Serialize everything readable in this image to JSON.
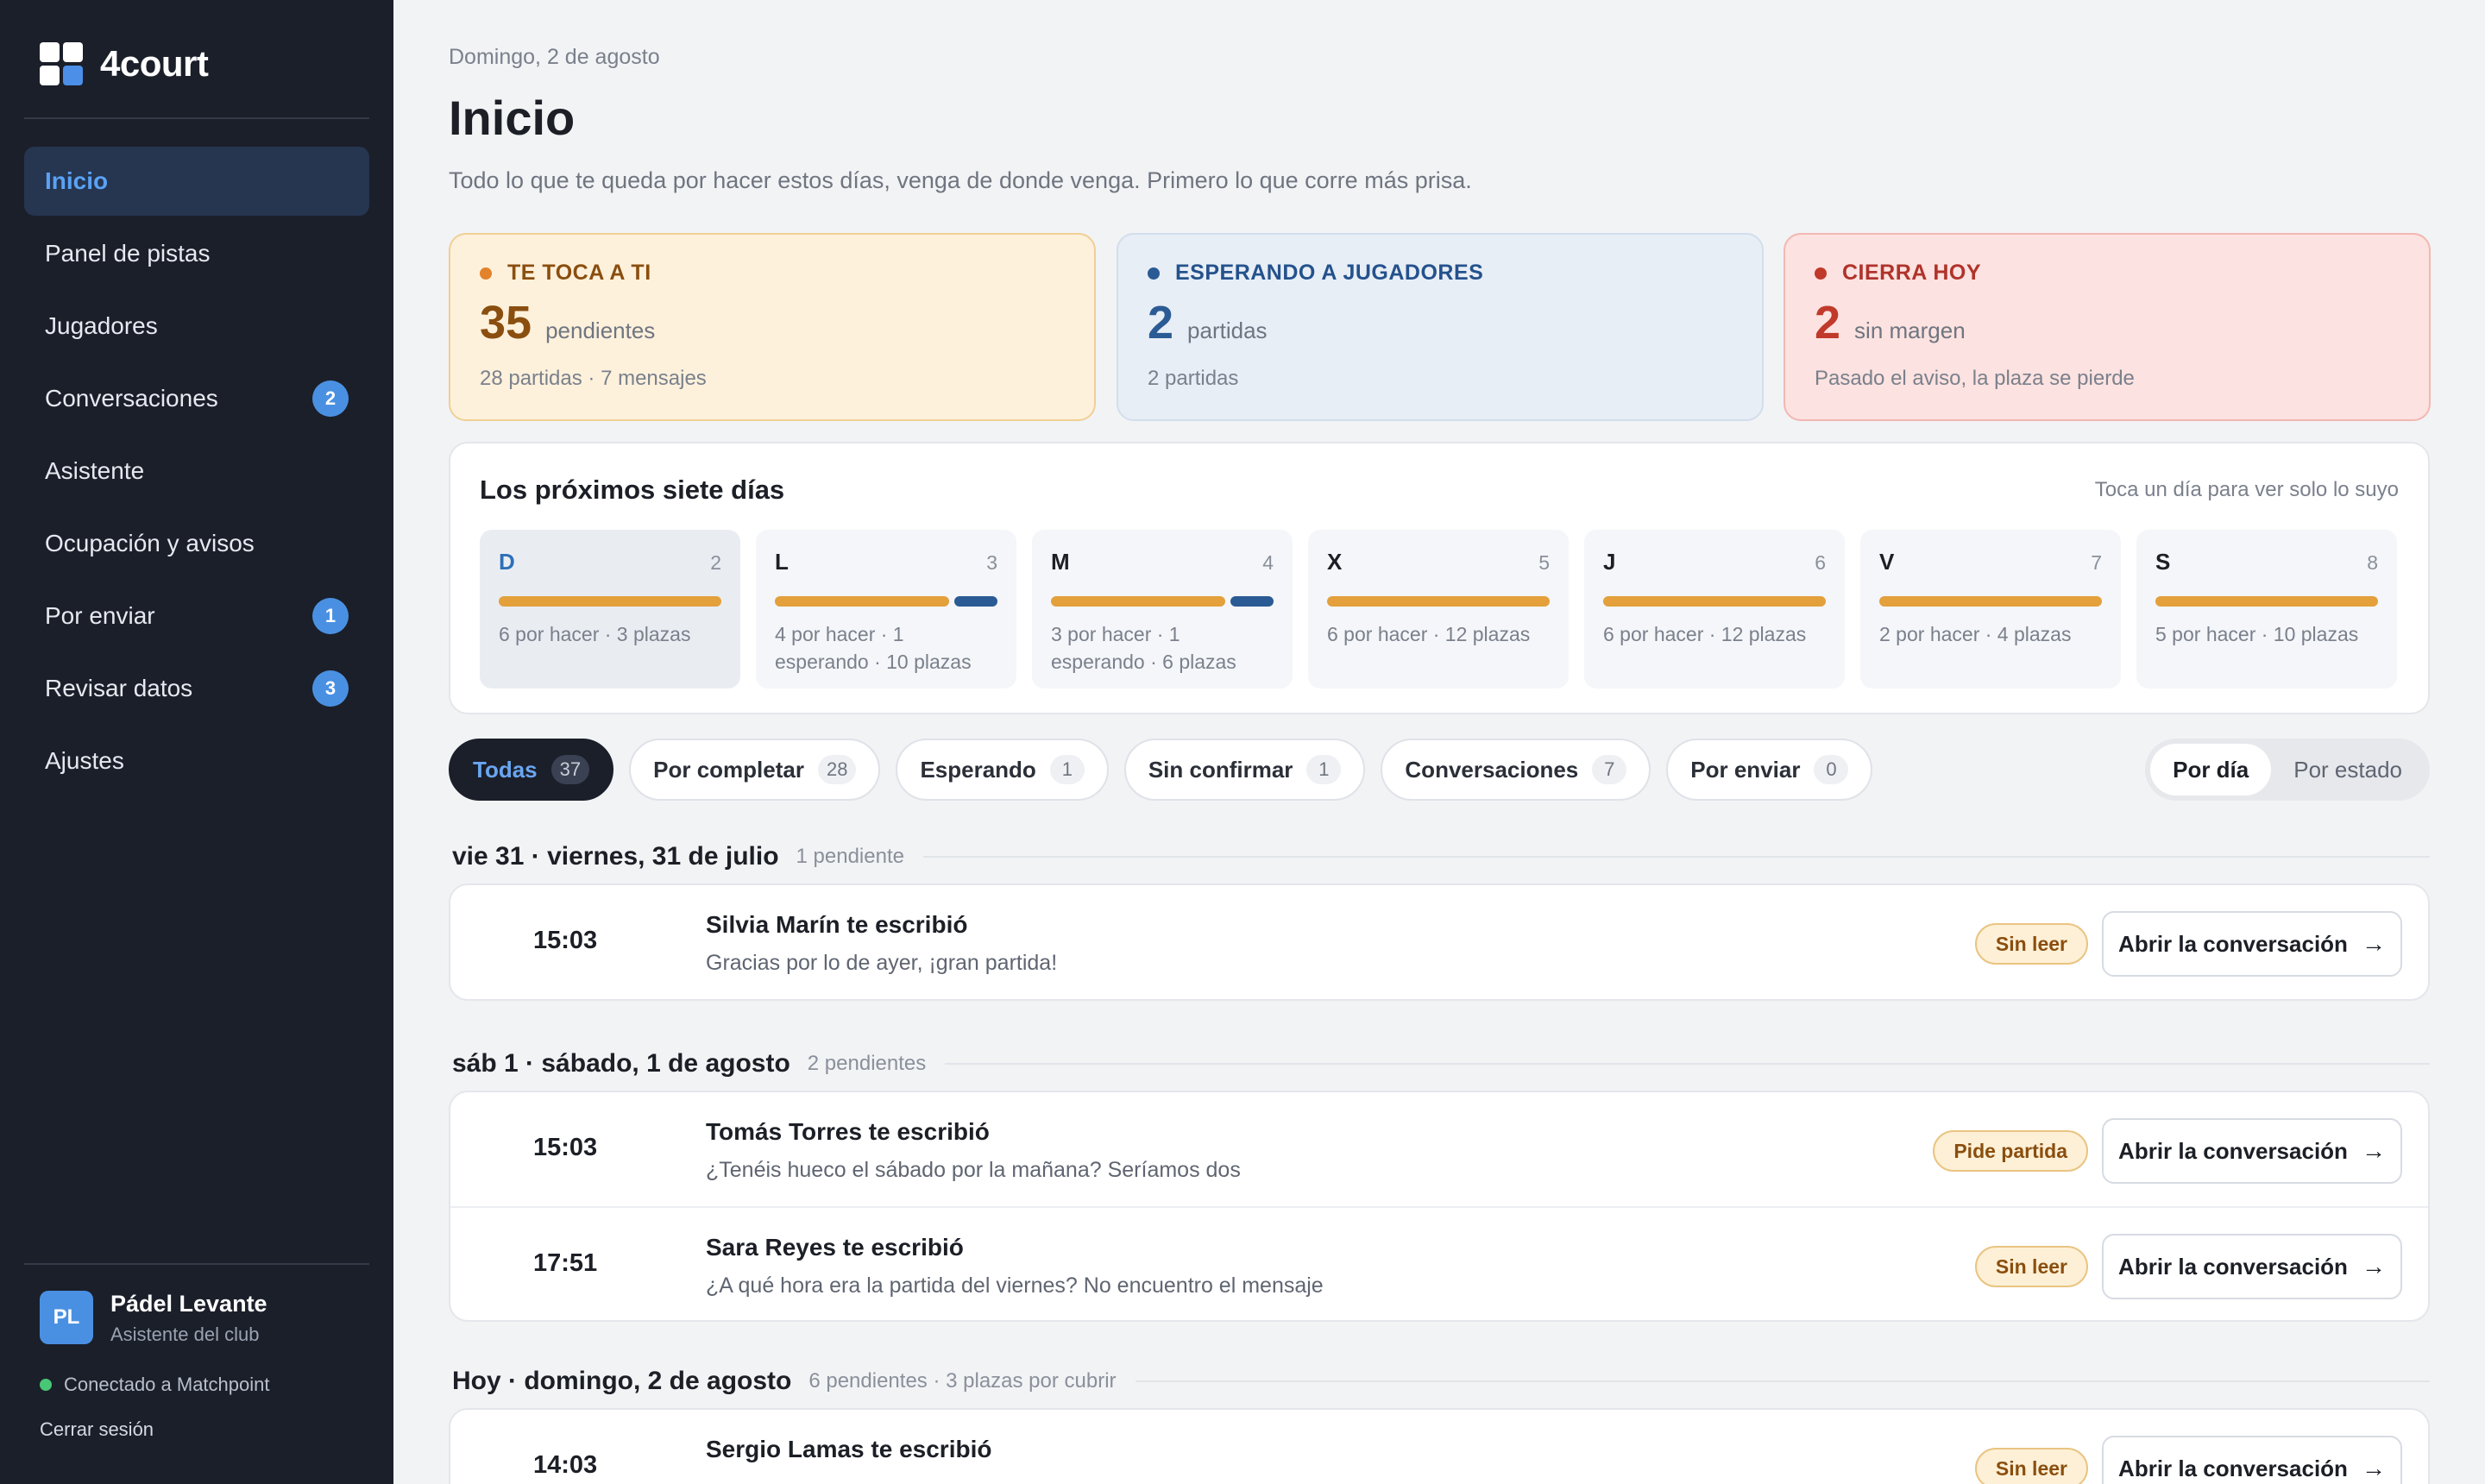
{
  "app": {
    "name": "4court"
  },
  "sidebar": {
    "items": [
      {
        "label": "Inicio",
        "active": true
      },
      {
        "label": "Panel de pistas"
      },
      {
        "label": "Jugadores"
      },
      {
        "label": "Conversaciones",
        "badge": "2"
      },
      {
        "label": "Asistente"
      },
      {
        "label": "Ocupación y avisos"
      },
      {
        "label": "Por enviar",
        "badge": "1"
      },
      {
        "label": "Revisar datos",
        "badge": "3"
      },
      {
        "label": "Ajustes"
      }
    ],
    "profile": {
      "initials": "PL",
      "name": "Pádel Levante",
      "role": "Asistente del club",
      "status": "Conectado a Matchpoint",
      "logout": "Cerrar sesión"
    }
  },
  "header": {
    "date": "Domingo, 2 de agosto",
    "title": "Inicio",
    "subtitle": "Todo lo que te queda por hacer estos días, venga de donde venga. Primero lo que corre más prisa."
  },
  "kpis": [
    {
      "label": "TE TOCA A TI",
      "value": "35",
      "unit": "pendientes",
      "detail": "28 partidas · 7 mensajes"
    },
    {
      "label": "ESPERANDO A JUGADORES",
      "value": "2",
      "unit": "partidas",
      "detail": "2 partidas"
    },
    {
      "label": "CIERRA HOY",
      "value": "2",
      "unit": "sin margen",
      "detail": "Pasado el aviso, la plaza se pierde"
    }
  ],
  "week": {
    "title": "Los próximos siete días",
    "hint": "Toca un día para ver solo lo suyo",
    "days": [
      {
        "letter": "D",
        "num": "2",
        "detail": "6 por hacer · 3 plazas",
        "waiting": false,
        "selected": true
      },
      {
        "letter": "L",
        "num": "3",
        "detail": "4 por hacer · 1 esperando · 10 plazas",
        "waiting": true
      },
      {
        "letter": "M",
        "num": "4",
        "detail": "3 por hacer · 1 esperando · 6 plazas",
        "waiting": true
      },
      {
        "letter": "X",
        "num": "5",
        "detail": "6 por hacer · 12 plazas",
        "waiting": false
      },
      {
        "letter": "J",
        "num": "6",
        "detail": "6 por hacer · 12 plazas",
        "waiting": false
      },
      {
        "letter": "V",
        "num": "7",
        "detail": "2 por hacer · 4 plazas",
        "waiting": false
      },
      {
        "letter": "S",
        "num": "8",
        "detail": "5 por hacer · 10 plazas",
        "waiting": false
      }
    ]
  },
  "filters": [
    {
      "label": "Todas",
      "count": "37",
      "active": true
    },
    {
      "label": "Por completar",
      "count": "28"
    },
    {
      "label": "Esperando",
      "count": "1"
    },
    {
      "label": "Sin confirmar",
      "count": "1"
    },
    {
      "label": "Conversaciones",
      "count": "7"
    },
    {
      "label": "Por enviar",
      "count": "0"
    }
  ],
  "view_toggle": {
    "by_day": "Por día",
    "by_state": "Por estado"
  },
  "groups": [
    {
      "title": "vie 31 · viernes, 31 de julio",
      "meta": "1 pendiente",
      "rows": [
        {
          "time": "15:03",
          "title": "Silvia Marín te escribió",
          "msg": "Gracias por lo de ayer, ¡gran partida!",
          "tag": "Sin leer",
          "action": "Abrir la conversación"
        }
      ]
    },
    {
      "title": "sáb 1 · sábado, 1 de agosto",
      "meta": "2 pendientes",
      "rows": [
        {
          "time": "15:03",
          "title": "Tomás Torres te escribió",
          "msg": "¿Tenéis hueco el sábado por la mañana? Seríamos dos",
          "tag": "Pide partida",
          "action": "Abrir la conversación"
        },
        {
          "time": "17:51",
          "title": "Sara Reyes te escribió",
          "msg": "¿A qué hora era la partida del viernes? No encuentro el mensaje",
          "tag": "Sin leer",
          "action": "Abrir la conversación"
        }
      ]
    },
    {
      "title": "Hoy · domingo, 2 de agosto",
      "meta": "6 pendientes · 3 plazas por cubrir",
      "rows": [
        {
          "time": "14:03",
          "title": "Sergio Lamas te escribió",
          "msg": "",
          "tag": "Sin leer",
          "action": "Abrir la conversación"
        }
      ]
    }
  ],
  "colors": {
    "sidebar_bg": "#1b1f2a",
    "accent_blue": "#4a90e2",
    "orange": "#e3a03b",
    "navy": "#2b5b94",
    "red": "#c0392b"
  }
}
